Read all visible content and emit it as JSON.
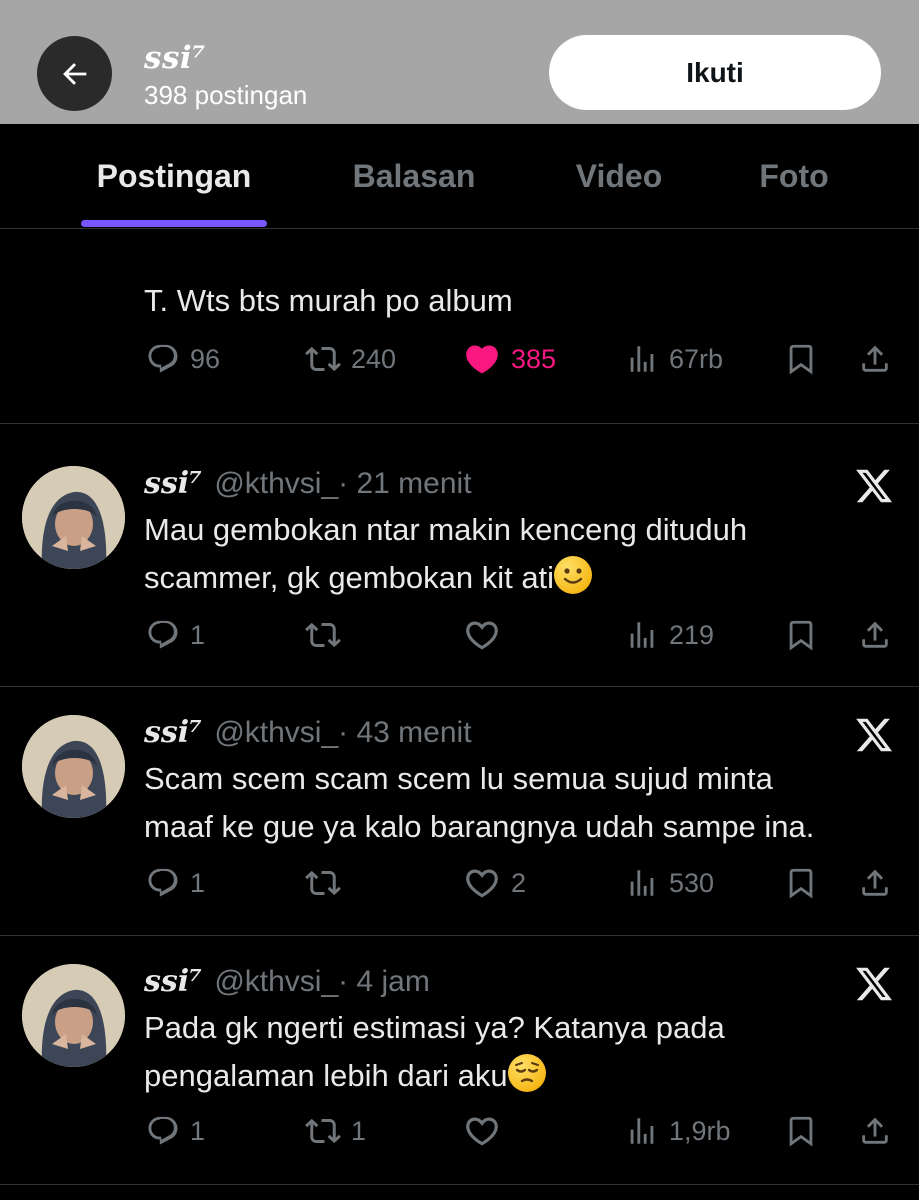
{
  "header": {
    "name": "ssi⁷",
    "post_count": "398 postingan",
    "follow_label": "Ikuti"
  },
  "tabs": [
    {
      "label": "Postingan",
      "active": true
    },
    {
      "label": "Balasan",
      "active": false
    },
    {
      "label": "Video",
      "active": false
    },
    {
      "label": "Foto",
      "active": false
    }
  ],
  "posts": [
    {
      "text": "T. Wts bts murah po album",
      "stats": {
        "replies": "96",
        "reposts": "240",
        "likes": "385",
        "views": "67rb"
      },
      "liked": true
    },
    {
      "name": "ssi⁷",
      "handle": "@kthvsi_",
      "time": " · 21 menit",
      "text_line1": "Mau gembokan ntar makin kenceng dituduh",
      "text_line2": "scammer, gk gembokan kit ati",
      "emoji": "slightly-smiling-face",
      "stats": {
        "replies": "1",
        "reposts": "",
        "likes": "",
        "views": "219"
      }
    },
    {
      "name": "ssi⁷",
      "handle": "@kthvsi_",
      "time": " · 43 menit",
      "text_line1": "Scam scem scam scem lu semua sujud minta",
      "text_line2": "maaf ke gue ya kalo barangnya udah sampe ina.",
      "stats": {
        "replies": "1",
        "reposts": "",
        "likes": "2",
        "views": "530"
      }
    },
    {
      "name": "ssi⁷",
      "handle": "@kthvsi_",
      "time": " · 4 jam",
      "text_line1": "Pada gk ngerti estimasi ya? Katanya pada",
      "text_line2": "pengalaman lebih dari aku",
      "emoji": "pensive-face",
      "stats": {
        "replies": "1",
        "reposts": "1",
        "likes": "",
        "views": "1,9rb"
      }
    }
  ],
  "colors": {
    "header_bg": "#a6a6a6",
    "accent_tab": "#7856ff",
    "like_pink": "#f91880",
    "muted": "#71767b"
  }
}
